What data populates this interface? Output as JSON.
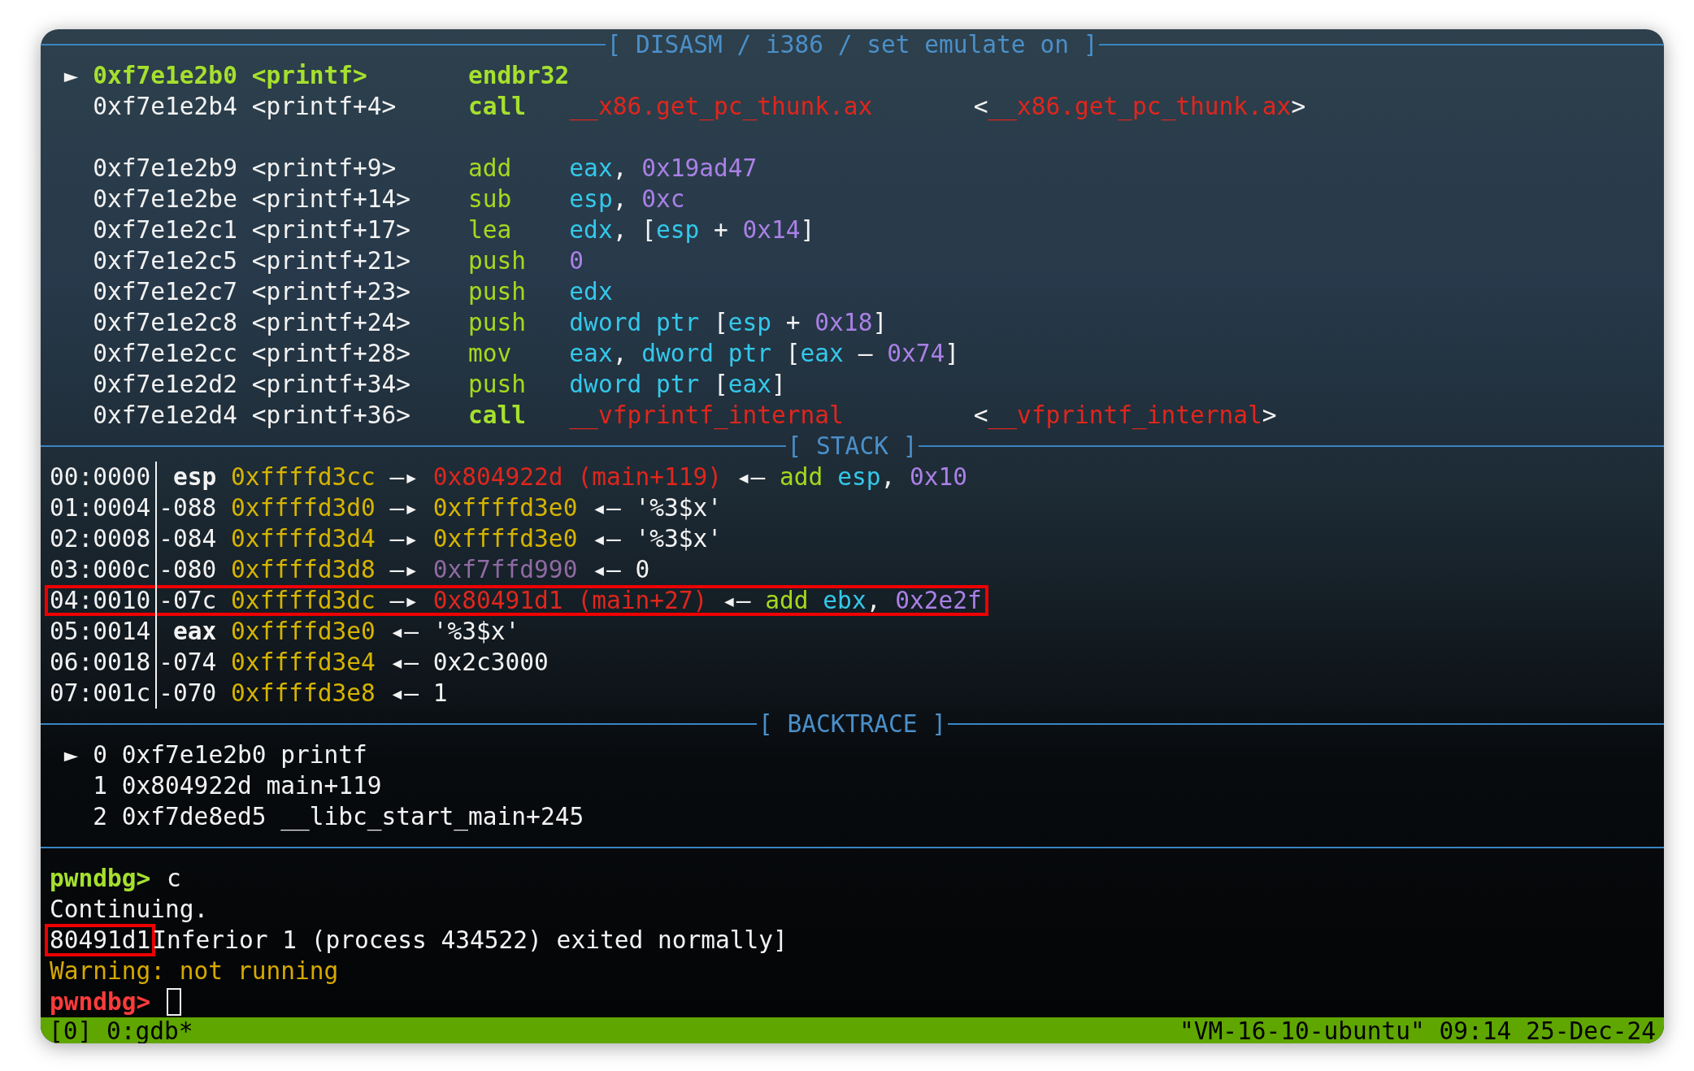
{
  "disasm": {
    "header": "[ DISASM / i386 / set emulate on ]",
    "rows": [
      {
        "kind": "instruction",
        "marker": "►",
        "current": true,
        "address": "0xf7e1e2b0",
        "symbol": "<printf>",
        "mnemonic": {
          "text": "endbr32",
          "kind": "current"
        }
      },
      {
        "kind": "instruction",
        "current": false,
        "address": "0xf7e1e2b4",
        "symbol": "<printf+4>",
        "mnemonic": {
          "text": "call",
          "kind": "keyword"
        },
        "operands": [
          {
            "text": "__x86.get_pc_thunk.ax",
            "kind": "function"
          }
        ],
        "annotation": [
          {
            "text": "<",
            "kind": "plain"
          },
          {
            "text": "__x86.get_pc_thunk.ax",
            "kind": "function"
          },
          {
            "text": ">",
            "kind": "plain"
          }
        ]
      },
      {
        "kind": "blank"
      },
      {
        "kind": "instruction",
        "current": false,
        "address": "0xf7e1e2b9",
        "symbol": "<printf+9>",
        "mnemonic": {
          "text": "add",
          "kind": "mnemonic"
        },
        "operands": [
          {
            "text": "eax",
            "kind": "register"
          },
          {
            "text": ",",
            "kind": "plain"
          },
          {
            "text": " 0x19ad47",
            "kind": "number"
          }
        ]
      },
      {
        "kind": "instruction",
        "current": false,
        "address": "0xf7e1e2be",
        "symbol": "<printf+14>",
        "mnemonic": {
          "text": "sub",
          "kind": "mnemonic"
        },
        "operands": [
          {
            "text": "esp",
            "kind": "register"
          },
          {
            "text": ",",
            "kind": "plain"
          },
          {
            "text": " 0xc",
            "kind": "number"
          }
        ]
      },
      {
        "kind": "instruction",
        "current": false,
        "address": "0xf7e1e2c1",
        "symbol": "<printf+17>",
        "mnemonic": {
          "text": "lea",
          "kind": "mnemonic"
        },
        "operands": [
          {
            "text": "edx",
            "kind": "register"
          },
          {
            "text": ",",
            "kind": "plain"
          },
          {
            "text": " [",
            "kind": "plain"
          },
          {
            "text": "esp",
            "kind": "register"
          },
          {
            "text": " +",
            "kind": "plain"
          },
          {
            "text": " 0x14",
            "kind": "number"
          },
          {
            "text": "]",
            "kind": "plain"
          }
        ]
      },
      {
        "kind": "instruction",
        "current": false,
        "address": "0xf7e1e2c5",
        "symbol": "<printf+21>",
        "mnemonic": {
          "text": "push",
          "kind": "mnemonic"
        },
        "operands": [
          {
            "text": "0",
            "kind": "number"
          }
        ]
      },
      {
        "kind": "instruction",
        "current": false,
        "address": "0xf7e1e2c7",
        "symbol": "<printf+23>",
        "mnemonic": {
          "text": "push",
          "kind": "mnemonic"
        },
        "operands": [
          {
            "text": "edx",
            "kind": "register"
          }
        ]
      },
      {
        "kind": "instruction",
        "current": false,
        "address": "0xf7e1e2c8",
        "symbol": "<printf+24>",
        "mnemonic": {
          "text": "push",
          "kind": "mnemonic"
        },
        "operands": [
          {
            "text": "dword ptr",
            "kind": "register"
          },
          {
            "text": " [",
            "kind": "plain"
          },
          {
            "text": "esp",
            "kind": "register"
          },
          {
            "text": " +",
            "kind": "plain"
          },
          {
            "text": " 0x18",
            "kind": "number"
          },
          {
            "text": "]",
            "kind": "plain"
          }
        ]
      },
      {
        "kind": "instruction",
        "current": false,
        "address": "0xf7e1e2cc",
        "symbol": "<printf+28>",
        "mnemonic": {
          "text": "mov",
          "kind": "mnemonic"
        },
        "operands": [
          {
            "text": "eax",
            "kind": "register"
          },
          {
            "text": ",",
            "kind": "plain"
          },
          {
            "text": " dword ptr",
            "kind": "register"
          },
          {
            "text": " [",
            "kind": "plain"
          },
          {
            "text": "eax",
            "kind": "register"
          },
          {
            "text": " –",
            "kind": "plain"
          },
          {
            "text": " 0x74",
            "kind": "number"
          },
          {
            "text": "]",
            "kind": "plain"
          }
        ]
      },
      {
        "kind": "instruction",
        "current": false,
        "address": "0xf7e1e2d2",
        "symbol": "<printf+34>",
        "mnemonic": {
          "text": "push",
          "kind": "mnemonic"
        },
        "operands": [
          {
            "text": "dword ptr",
            "kind": "register"
          },
          {
            "text": " [",
            "kind": "plain"
          },
          {
            "text": "eax",
            "kind": "register"
          },
          {
            "text": "]",
            "kind": "plain"
          }
        ]
      },
      {
        "kind": "instruction",
        "current": false,
        "address": "0xf7e1e2d4",
        "symbol": "<printf+36>",
        "mnemonic": {
          "text": "call",
          "kind": "keyword"
        },
        "operands": [
          {
            "text": "__vfprintf_internal",
            "kind": "function"
          }
        ],
        "annotation": [
          {
            "text": "<",
            "kind": "plain"
          },
          {
            "text": "__vfprintf_internal",
            "kind": "function"
          },
          {
            "text": ">",
            "kind": "plain"
          }
        ]
      }
    ]
  },
  "stack": {
    "header": "[ STACK ]",
    "rows": [
      {
        "index": "00:0000",
        "slot": "esp",
        "kind": "register",
        "highlighted": false,
        "segments": [
          {
            "text": "0xffffd3cc",
            "kind": "stack"
          },
          {
            "text": " —▸",
            "kind": "plain"
          },
          {
            "text": " 0x804922d (main+119)",
            "kind": "code"
          },
          {
            "text": " ◂—",
            "kind": "plain"
          },
          {
            "text": " add",
            "kind": "mnemonic"
          },
          {
            "text": " esp",
            "kind": "register"
          },
          {
            "text": ",",
            "kind": "plain"
          },
          {
            "text": " 0x10",
            "kind": "number"
          }
        ]
      },
      {
        "index": "01:0004",
        "slot": "-088",
        "kind": "offset",
        "highlighted": false,
        "segments": [
          {
            "text": "0xffffd3d0",
            "kind": "stack"
          },
          {
            "text": " —▸",
            "kind": "plain"
          },
          {
            "text": " 0xffffd3e0",
            "kind": "stack"
          },
          {
            "text": " ◂—",
            "kind": "plain"
          },
          {
            "text": " '%3$x'",
            "kind": "plain"
          }
        ]
      },
      {
        "index": "02:0008",
        "slot": "-084",
        "kind": "offset",
        "highlighted": false,
        "segments": [
          {
            "text": "0xffffd3d4",
            "kind": "stack"
          },
          {
            "text": " —▸",
            "kind": "plain"
          },
          {
            "text": " 0xffffd3e0",
            "kind": "stack"
          },
          {
            "text": " ◂—",
            "kind": "plain"
          },
          {
            "text": " '%3$x'",
            "kind": "plain"
          }
        ]
      },
      {
        "index": "03:000c",
        "slot": "-080",
        "kind": "offset",
        "highlighted": false,
        "segments": [
          {
            "text": "0xffffd3d8",
            "kind": "stack"
          },
          {
            "text": " —▸",
            "kind": "plain"
          },
          {
            "text": " 0xf7ffd990",
            "kind": "data"
          },
          {
            "text": " ◂—",
            "kind": "plain"
          },
          {
            "text": " 0",
            "kind": "plain"
          }
        ]
      },
      {
        "index": "04:0010",
        "slot": "-07c",
        "kind": "offset",
        "highlighted": true,
        "segments": [
          {
            "text": "0xffffd3dc",
            "kind": "stack"
          },
          {
            "text": " —▸",
            "kind": "plain"
          },
          {
            "text": " 0x80491d1 (main+27)",
            "kind": "code"
          },
          {
            "text": " ◂—",
            "kind": "plain"
          },
          {
            "text": " add",
            "kind": "mnemonic"
          },
          {
            "text": " ebx",
            "kind": "register"
          },
          {
            "text": ",",
            "kind": "plain"
          },
          {
            "text": " 0x2e2f",
            "kind": "number"
          }
        ]
      },
      {
        "index": "05:0014",
        "slot": "eax",
        "kind": "register",
        "highlighted": false,
        "segments": [
          {
            "text": "0xffffd3e0",
            "kind": "stack"
          },
          {
            "text": " ◂—",
            "kind": "plain"
          },
          {
            "text": " '%3$x'",
            "kind": "plain"
          }
        ]
      },
      {
        "index": "06:0018",
        "slot": "-074",
        "kind": "offset",
        "highlighted": false,
        "segments": [
          {
            "text": "0xffffd3e4",
            "kind": "stack"
          },
          {
            "text": " ◂—",
            "kind": "plain"
          },
          {
            "text": " 0x2c3000",
            "kind": "plain"
          }
        ]
      },
      {
        "index": "07:001c",
        "slot": "-070",
        "kind": "offset",
        "highlighted": false,
        "segments": [
          {
            "text": "0xffffd3e8",
            "kind": "stack"
          },
          {
            "text": " ◂—",
            "kind": "plain"
          },
          {
            "text": " 1",
            "kind": "plain"
          }
        ]
      }
    ]
  },
  "backtrace": {
    "header": "[ BACKTRACE ]",
    "frames": [
      {
        "marker": "►",
        "number": "0",
        "address": "0xf7e1e2b0",
        "symbol": "printf"
      },
      {
        "number": "1",
        "address": "0x804922d",
        "symbol": "main+119"
      },
      {
        "number": "2",
        "address": "0xf7de8ed5",
        "symbol": "__libc_start_main+245"
      }
    ]
  },
  "console": [
    {
      "cursor": false,
      "segments": [
        {
          "text": "pwndbg>",
          "kind": "prompt",
          "highlighted": false
        },
        {
          "text": " c",
          "kind": "plain",
          "highlighted": false
        }
      ]
    },
    {
      "cursor": false,
      "segments": [
        {
          "text": "Continuing.",
          "kind": "plain",
          "highlighted": false
        }
      ]
    },
    {
      "cursor": false,
      "segments": [
        {
          "text": "80491d1",
          "kind": "plain",
          "highlighted": true
        },
        {
          "text": "Inferior 1 (process 434522) exited normally]",
          "kind": "plain",
          "highlighted": false
        }
      ]
    },
    {
      "cursor": false,
      "segments": [
        {
          "text": "Warning: not running",
          "kind": "warning",
          "highlighted": false
        }
      ]
    },
    {
      "cursor": true,
      "segments": [
        {
          "text": "pwndbg>",
          "kind": "prompt_error",
          "highlighted": false
        }
      ]
    }
  ],
  "status_bar": {
    "left": "[0] 0:gdb*",
    "right": "\"VM-16-10-ubuntu\" 09:14 25-Dec-24"
  }
}
